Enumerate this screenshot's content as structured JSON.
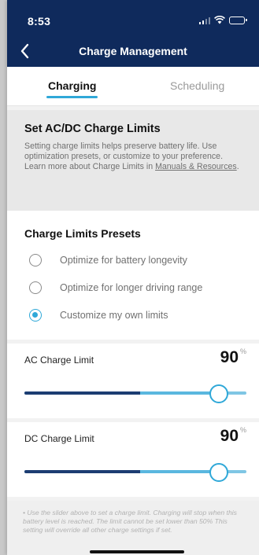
{
  "status_bar": {
    "time": "8:53"
  },
  "nav": {
    "title": "Charge Management"
  },
  "tabs": [
    {
      "label": "Charging"
    },
    {
      "label": "Scheduling"
    }
  ],
  "info": {
    "heading": "Set AC/DC Charge Limits",
    "body": "Setting charge limits helps preserve battery life. Use optimization presets, or customize to your preference. Learn more about Charge Limits in ",
    "link": "Manuals & Resources",
    "end": "."
  },
  "presets": {
    "heading": "Charge Limits Presets",
    "options": [
      {
        "label": "Optimize for battery longevity",
        "selected": false
      },
      {
        "label": "Optimize for longer driving range",
        "selected": false
      },
      {
        "label": "Customize my own limits",
        "selected": true
      }
    ]
  },
  "ac_limit": {
    "label": "AC Charge Limit",
    "value": "90",
    "unit": "%",
    "slider_fraction": 0.875
  },
  "dc_limit": {
    "label": "DC Charge Limit",
    "value": "90",
    "unit": "%",
    "slider_fraction": 0.875
  },
  "footnote": "• Use the slider above to set a charge limit. Charging will stop when this battery level is reached. The limit cannot be set lower than 50% This setting will override all other charge settings if set.",
  "colors": {
    "header": "#0f2a5c",
    "accent": "#2fa8d8",
    "track_dark": "#1c3d72"
  }
}
